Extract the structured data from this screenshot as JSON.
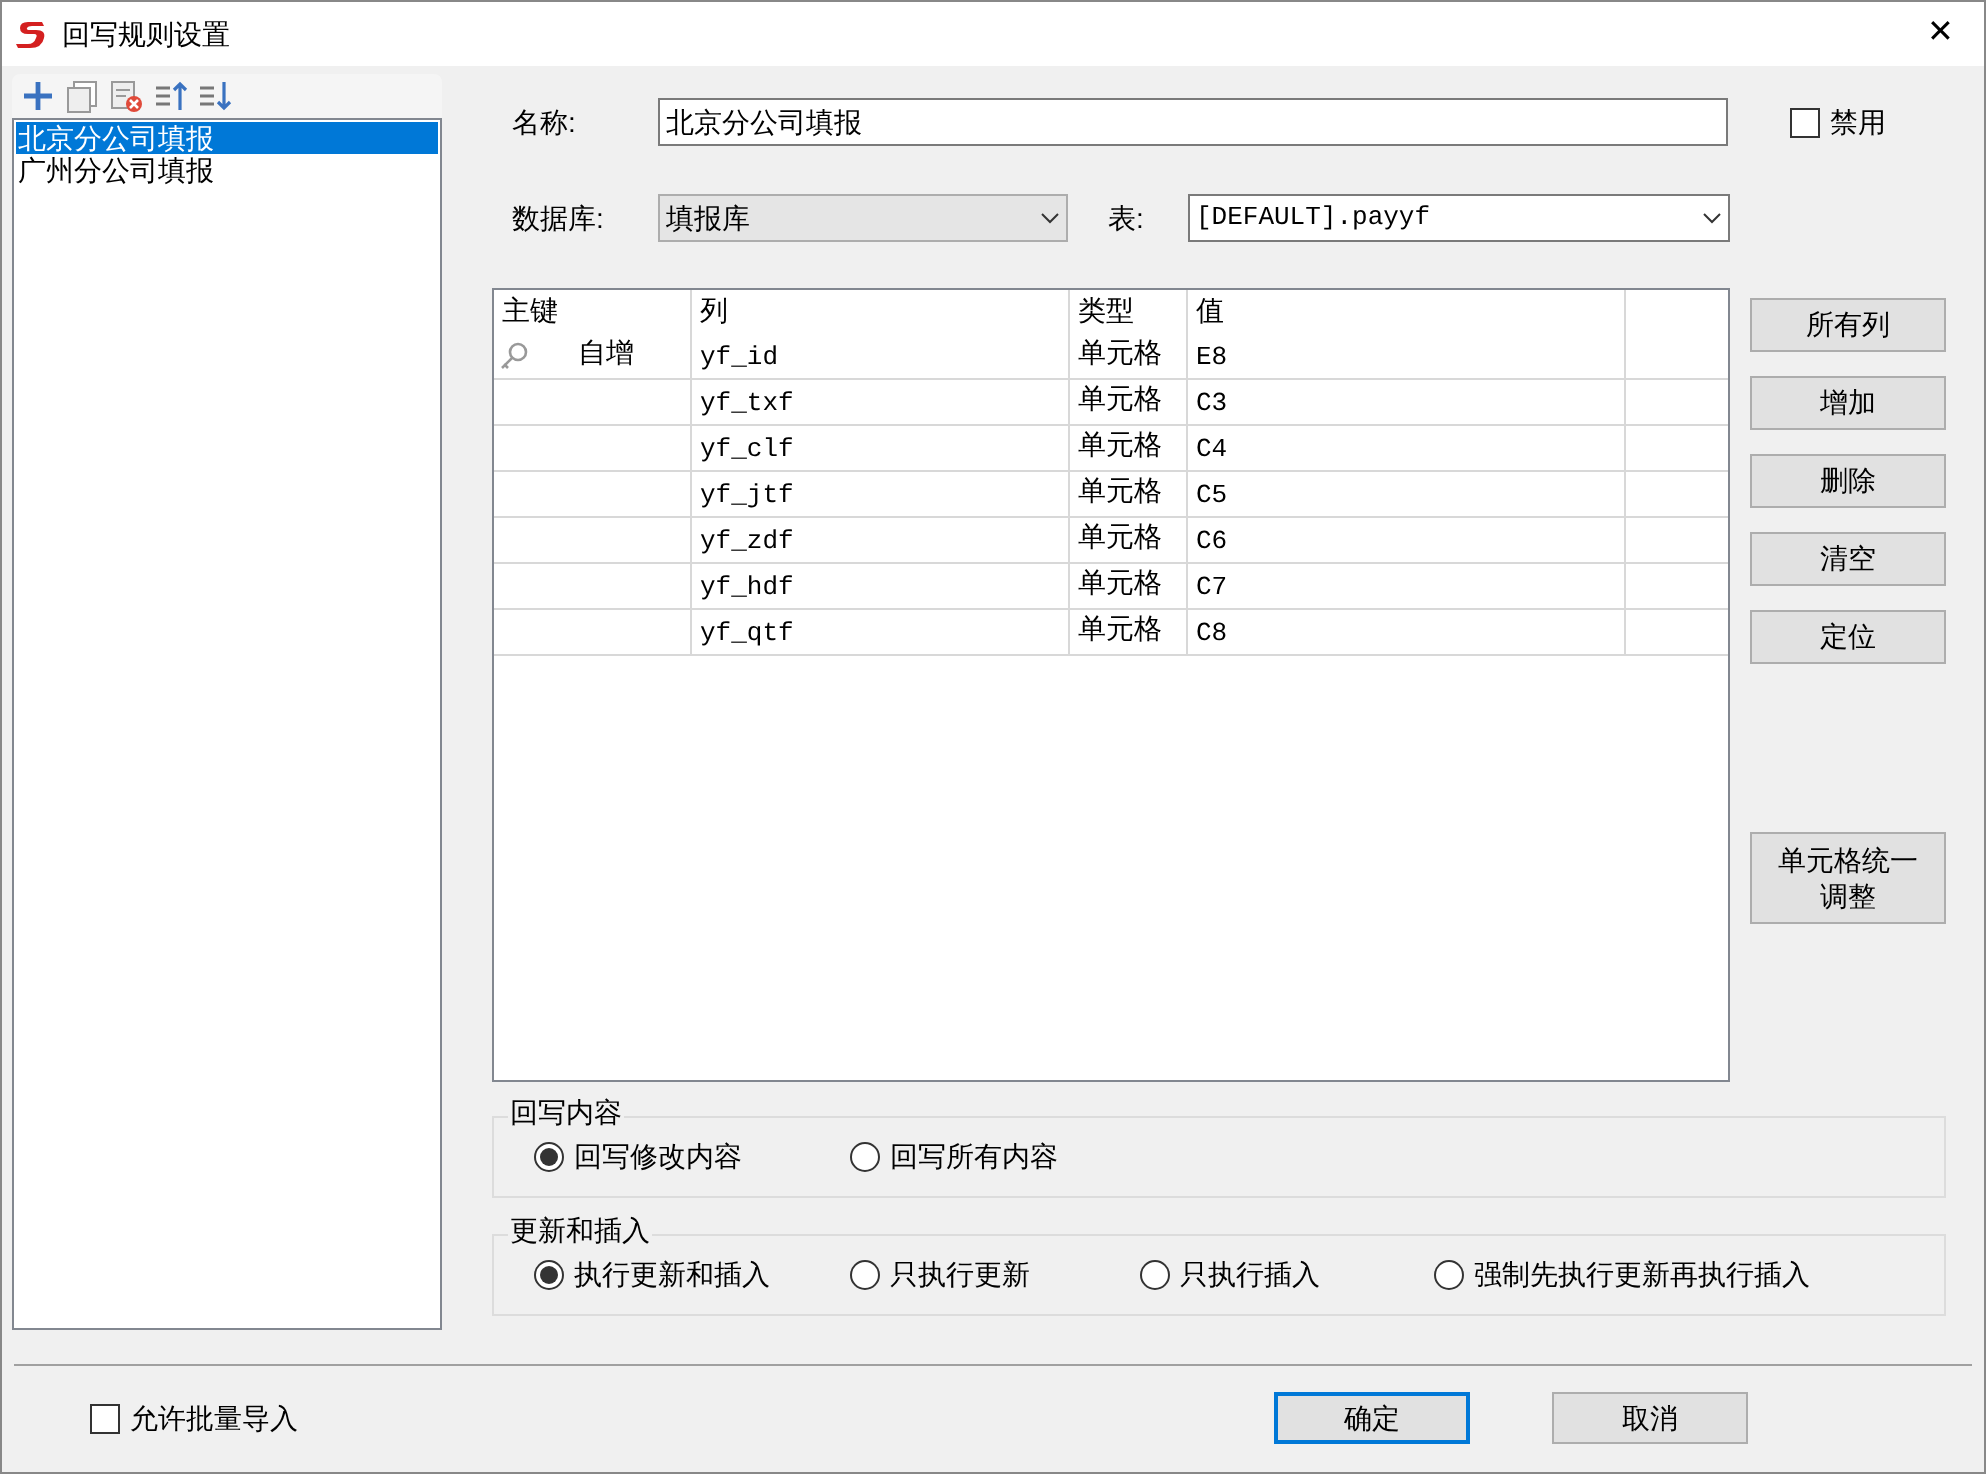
{
  "window": {
    "title": "回写规则设置",
    "close": "✕"
  },
  "rules": [
    {
      "label": "北京分公司填报",
      "selected": true
    },
    {
      "label": "广州分公司填报",
      "selected": false
    }
  ],
  "form": {
    "name_label": "名称:",
    "name_value": "北京分公司填报",
    "disabled": {
      "label": "禁用",
      "checked": false
    },
    "database_label": "数据库:",
    "database_value": "填报库",
    "table_label": "表:",
    "table_value": "[DEFAULT].payyf"
  },
  "grid": {
    "columns": [
      "主键",
      "列",
      "类型",
      "值"
    ],
    "rows": [
      {
        "primary_key": true,
        "key_text": "自增",
        "column": "yf_id",
        "type": "单元格",
        "value": "E8"
      },
      {
        "primary_key": false,
        "column": "yf_txf",
        "type": "单元格",
        "value": "C3"
      },
      {
        "primary_key": false,
        "column": "yf_clf",
        "type": "单元格",
        "value": "C4"
      },
      {
        "primary_key": false,
        "column": "yf_jtf",
        "type": "单元格",
        "value": "C5"
      },
      {
        "primary_key": false,
        "column": "yf_zdf",
        "type": "单元格",
        "value": "C6"
      },
      {
        "primary_key": false,
        "column": "yf_hdf",
        "type": "单元格",
        "value": "C7"
      },
      {
        "primary_key": false,
        "column": "yf_qtf",
        "type": "单元格",
        "value": "C8"
      }
    ]
  },
  "side_buttons": [
    "所有列",
    "增加",
    "删除",
    "清空",
    "定位"
  ],
  "adjust_button": "单元格统一调整",
  "writeback": {
    "title": "回写内容",
    "options": [
      {
        "label": "回写修改内容",
        "selected": true
      },
      {
        "label": "回写所有内容",
        "selected": false
      }
    ]
  },
  "update": {
    "title": "更新和插入",
    "options": [
      {
        "label": "执行更新和插入",
        "selected": true
      },
      {
        "label": "只执行更新",
        "selected": false
      },
      {
        "label": "只执行插入",
        "selected": false
      },
      {
        "label": "强制先执行更新再执行插入",
        "selected": false
      }
    ]
  },
  "batch_import": {
    "label": "允许批量导入",
    "checked": false
  },
  "ok": "确定",
  "cancel": "取消"
}
